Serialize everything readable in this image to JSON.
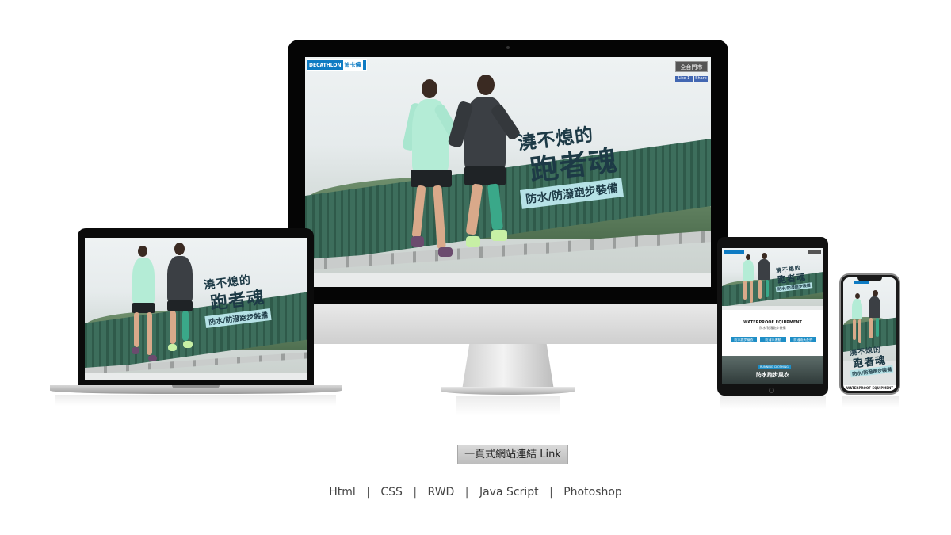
{
  "site": {
    "logo_brand": "DECATHLON",
    "logo_cn": "迪卡儂",
    "stores_button": "全台門市",
    "fb_like": "Like 1",
    "fb_share": "Share",
    "hero_title_line1": "澆不熄的",
    "hero_title_line2": "跑者魂",
    "hero_subtitle": "防水/防潑跑步裝備"
  },
  "tablet": {
    "section_title": "WATERPROOF EQUIPMENT",
    "section_sub": "防水/防潑跑步裝備",
    "buttons": [
      "防水跑步風衣",
      "防潑水運動",
      "防潑雨天配件"
    ],
    "banner_tag": "RUNNING CLOTHING",
    "banner_title": "防水跑步風衣"
  },
  "phone": {
    "section_title": "WATERPROOF EQUIPMENT"
  },
  "footer": {
    "link_label": "一頁式網站連結  Link",
    "technologies": [
      "Html",
      "CSS",
      "RWD",
      "Java Script",
      "Photoshop"
    ],
    "separator": "|"
  },
  "colors": {
    "brand_blue": "#0e7bc3",
    "title_dark": "#1d3a46",
    "subtitle_bg": "#b6e2e6",
    "button_blue": "#1e8ec6"
  }
}
